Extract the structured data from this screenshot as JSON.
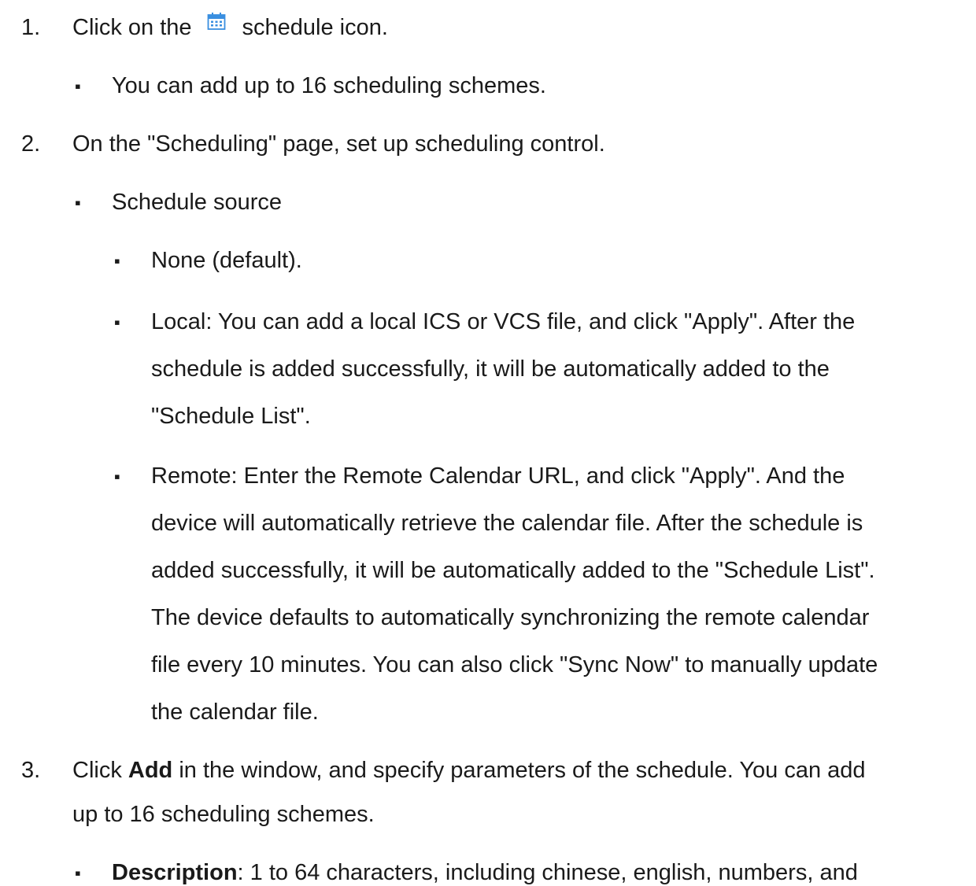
{
  "steps": [
    {
      "number": "1.",
      "text_before_icon": "Click on the",
      "icon": "calendar-icon",
      "text_after_icon": "schedule icon.",
      "bullets": [
        {
          "text": "You can add up to 16 scheduling schemes."
        }
      ]
    },
    {
      "number": "2.",
      "text": "On the \"Scheduling\" page, set up scheduling control.",
      "bullets": [
        {
          "text": "Schedule source",
          "sub_bullets": [
            {
              "lines": [
                "None (default)."
              ]
            },
            {
              "lines": [
                "Local: You can add a local ICS or VCS file, and click \"Apply\". After the",
                "schedule is added successfully, it will be automatically added to the",
                "\"Schedule List\"."
              ]
            },
            {
              "lines": [
                "Remote: Enter the Remote Calendar URL, and click \"Apply\". And the",
                "device will automatically retrieve the calendar file. After the schedule is",
                "added successfully, it will be automatically added to the \"Schedule List\".",
                "The device defaults to automatically synchronizing the remote calendar",
                "file every 10 minutes. You can also click \"Sync Now\" to manually update",
                "the calendar file."
              ]
            }
          ]
        }
      ]
    },
    {
      "number": "3.",
      "line1_prefix": "Click ",
      "line1_bold": "Add",
      "line1_suffix": " in the window, and specify parameters of the schedule. You can add",
      "line2": "up to 16 scheduling schemes.",
      "bullets": [
        {
          "bold": "Description",
          "text": ": 1 to 64 characters, including chinese, english, numbers, and"
        }
      ]
    }
  ],
  "bullet_glyph": "▪",
  "colors": {
    "text": "#1a1a1a",
    "icon_blue": "#3a8fe0"
  }
}
